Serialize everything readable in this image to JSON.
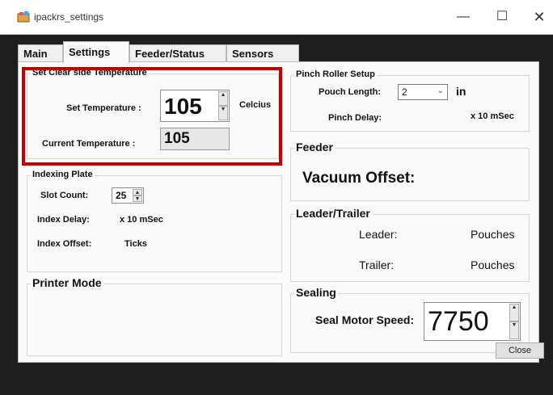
{
  "window": {
    "title": "ipackrs_settings",
    "minimize_glyph": "—",
    "maximize_glyph": "☐",
    "close_glyph": "✕"
  },
  "tabs": [
    {
      "label": "Main"
    },
    {
      "label": "Settings"
    },
    {
      "label": "Feeder/Status"
    },
    {
      "label": "Sensors"
    }
  ],
  "active_tab": "Settings",
  "temperature": {
    "title": "Set Clear side Temperature",
    "set_label": "Set Temperature :",
    "set_value": "105",
    "unit": "Celcius",
    "current_label": "Current Temperature :",
    "current_value": "105"
  },
  "indexing": {
    "title": "Indexing Plate",
    "slot_count_label": "Slot Count:",
    "slot_count_value": "25",
    "index_delay_label": "Index Delay:",
    "index_delay_unit": "x 10 mSec",
    "index_offset_label": "Index Offset:",
    "index_offset_unit": "Ticks"
  },
  "printer": {
    "title": "Printer Mode"
  },
  "pinch": {
    "title": "Pinch Roller Setup",
    "pouch_length_label": "Pouch Length:",
    "pouch_length_value": "2",
    "pouch_length_unit": "in",
    "pinch_delay_label": "Pinch Delay:",
    "pinch_delay_unit": "x 10 mSec"
  },
  "feeder": {
    "title": "Feeder",
    "vacuum_offset_label": "Vacuum Offset:"
  },
  "leader_trailer": {
    "title": "Leader/Trailer",
    "leader_label": "Leader:",
    "leader_unit": "Pouches",
    "trailer_label": "Trailer:",
    "trailer_unit": "Pouches"
  },
  "sealing": {
    "title": "Sealing",
    "speed_label": "Seal Motor Speed:",
    "speed_value": "7750"
  },
  "footer": {
    "close_label": "Close"
  },
  "colors": {
    "highlight": "#c00000",
    "background": "#1f1f1f",
    "panel": "#fafafa"
  },
  "icons": {
    "app": "app-icon",
    "spin": "spin-arrow-icons",
    "combo": "chevron-down-icon"
  }
}
